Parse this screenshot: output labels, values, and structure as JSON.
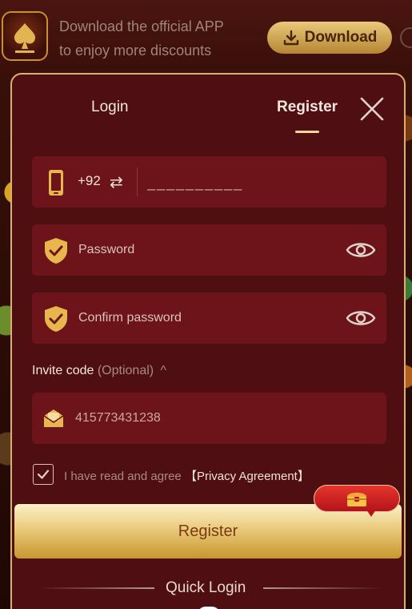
{
  "banner": {
    "line1": "Download the official APP",
    "line2": "to enjoy more discounts",
    "download_label": "Download",
    "logo_icon": "spade-logo-icon"
  },
  "tabs": {
    "login_label": "Login",
    "register_label": "Register",
    "active": "Register"
  },
  "form": {
    "country_code": "+92",
    "swap_glyph": "⇄",
    "phone_placeholder": "__________",
    "password_placeholder": "Password",
    "confirm_placeholder": "Confirm password",
    "invite_label": "Invite code",
    "invite_optional": "(Optional)",
    "invite_caret": "^",
    "invite_value": "415773431238",
    "agree_text": "I have read and agree",
    "agree_link": "【Privacy Agreement】",
    "agree_checked": true,
    "register_button": "Register",
    "quick_login": "Quick Login"
  },
  "colors": {
    "modal_bg": "#4f0f12",
    "field_bg": "#6d141a",
    "gold": "#d9b26a",
    "accent_red": "#d8262a"
  }
}
